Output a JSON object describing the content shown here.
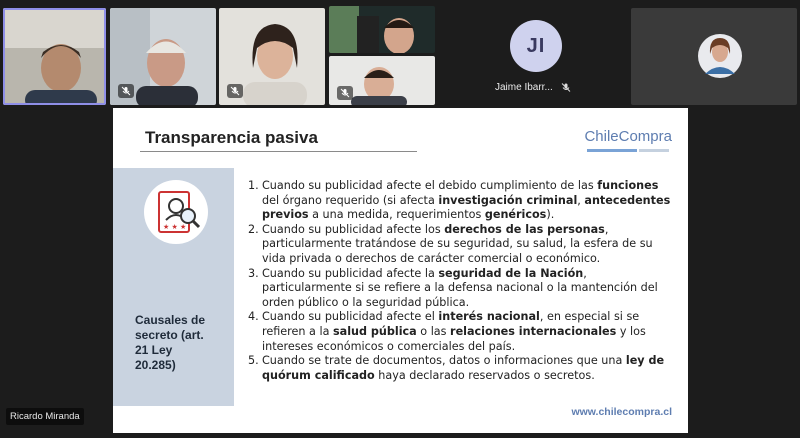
{
  "participants": {
    "ricardo_name": "Ricardo Miranda",
    "initials_name": "Jaime Ibarr...",
    "initials": "JI"
  },
  "slide": {
    "title": "Transparencia pasiva",
    "logo": "ChileCompra",
    "website": "www.chilecompra.cl",
    "sidebar_label": "Causales de\nsecreto (art.\n21 Ley\n20.285)",
    "items": [
      {
        "n": "1.",
        "segments": [
          {
            "t": "Cuando su publicidad afecte el debido cumplimiento de las "
          },
          {
            "t": "funciones",
            "b": true
          },
          {
            "t": " del órgano requerido (si afecta "
          },
          {
            "t": "investigación criminal",
            "b": true
          },
          {
            "t": ", "
          },
          {
            "t": "antecedentes previos",
            "b": true
          },
          {
            "t": " a una medida, requerimientos "
          },
          {
            "t": "genéricos",
            "b": true
          },
          {
            "t": ")."
          }
        ]
      },
      {
        "n": "2.",
        "segments": [
          {
            "t": "Cuando su publicidad afecte los "
          },
          {
            "t": "derechos de las personas",
            "b": true
          },
          {
            "t": ", particularmente tratándose de su seguridad, su salud, la esfera de su vida privada o derechos de carácter comercial o económico."
          }
        ]
      },
      {
        "n": "3.",
        "segments": [
          {
            "t": "Cuando su publicidad afecte la "
          },
          {
            "t": "seguridad de la Nación",
            "b": true
          },
          {
            "t": ", particularmente si se refiere a la defensa nacional o la mantención del orden público o la seguridad pública."
          }
        ]
      },
      {
        "n": "4.",
        "segments": [
          {
            "t": "Cuando su publicidad afecte el "
          },
          {
            "t": "interés nacional",
            "b": true
          },
          {
            "t": ", en especial si se refieren a la "
          },
          {
            "t": "salud pública",
            "b": true
          },
          {
            "t": " o las "
          },
          {
            "t": "relaciones internacionales",
            "b": true
          },
          {
            "t": " y los intereses económicos o comerciales del país."
          }
        ]
      },
      {
        "n": "5.",
        "segments": [
          {
            "t": "Cuando se trate de documentos, datos o informaciones que una "
          },
          {
            "t": "ley de quórum calificado",
            "b": true
          },
          {
            "t": " haya declarado reservados o secretos."
          }
        ]
      }
    ]
  },
  "colors": {
    "active_border": "#8f8fe8",
    "logo_blue": "#5e7db0",
    "sidebar_bg": "#c9d3e0"
  }
}
